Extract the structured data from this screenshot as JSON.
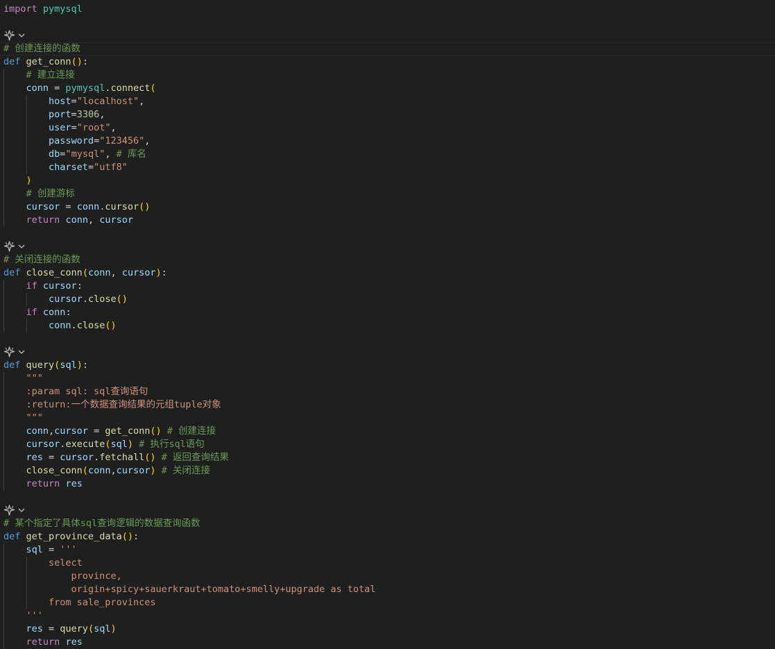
{
  "editor": {
    "lines": [
      [
        {
          "t": "import",
          "c": "ctl"
        },
        {
          "t": " "
        },
        {
          "t": "pymysql",
          "c": "mod"
        }
      ],
      [],
      "LENS",
      [
        {
          "t": "# 创建连接的函数",
          "c": "cm"
        }
      ],
      [
        {
          "t": "def",
          "c": "kw"
        },
        {
          "t": " "
        },
        {
          "t": "get_conn",
          "c": "fn"
        },
        {
          "t": "()",
          "c": "p1"
        },
        {
          "t": ":"
        }
      ],
      [
        {
          "t": "    "
        },
        {
          "t": "# 建立连接",
          "c": "cm"
        }
      ],
      [
        {
          "t": "    "
        },
        {
          "t": "conn",
          "c": "var"
        },
        {
          "t": " = "
        },
        {
          "t": "pymysql",
          "c": "mod"
        },
        {
          "t": "."
        },
        {
          "t": "connect",
          "c": "fn"
        },
        {
          "t": "(",
          "c": "p1"
        }
      ],
      [
        {
          "t": "        "
        },
        {
          "t": "host",
          "c": "var"
        },
        {
          "t": "="
        },
        {
          "t": "\"localhost\"",
          "c": "str"
        },
        {
          "t": ","
        }
      ],
      [
        {
          "t": "        "
        },
        {
          "t": "port",
          "c": "var"
        },
        {
          "t": "="
        },
        {
          "t": "3306",
          "c": "num"
        },
        {
          "t": ","
        }
      ],
      [
        {
          "t": "        "
        },
        {
          "t": "user",
          "c": "var"
        },
        {
          "t": "="
        },
        {
          "t": "\"root\"",
          "c": "str"
        },
        {
          "t": ","
        }
      ],
      [
        {
          "t": "        "
        },
        {
          "t": "password",
          "c": "var"
        },
        {
          "t": "="
        },
        {
          "t": "\"123456\"",
          "c": "str"
        },
        {
          "t": ","
        }
      ],
      [
        {
          "t": "        "
        },
        {
          "t": "db",
          "c": "var"
        },
        {
          "t": "="
        },
        {
          "t": "\"mysql\"",
          "c": "str"
        },
        {
          "t": ", "
        },
        {
          "t": "# 库名",
          "c": "cm"
        }
      ],
      [
        {
          "t": "        "
        },
        {
          "t": "charset",
          "c": "var"
        },
        {
          "t": "="
        },
        {
          "t": "\"utf8\"",
          "c": "str"
        }
      ],
      [
        {
          "t": "    "
        },
        {
          "t": ")",
          "c": "p1"
        }
      ],
      [
        {
          "t": "    "
        },
        {
          "t": "# 创建游标",
          "c": "cm"
        }
      ],
      [
        {
          "t": "    "
        },
        {
          "t": "cursor",
          "c": "var"
        },
        {
          "t": " = "
        },
        {
          "t": "conn",
          "c": "var"
        },
        {
          "t": "."
        },
        {
          "t": "cursor",
          "c": "fn"
        },
        {
          "t": "()",
          "c": "p1"
        }
      ],
      [
        {
          "t": "    "
        },
        {
          "t": "return",
          "c": "ctl"
        },
        {
          "t": " "
        },
        {
          "t": "conn",
          "c": "var"
        },
        {
          "t": ", "
        },
        {
          "t": "cursor",
          "c": "var"
        }
      ],
      [],
      "LENS",
      [
        {
          "t": "# 关闭连接的函数",
          "c": "cm"
        }
      ],
      [
        {
          "t": "def",
          "c": "kw"
        },
        {
          "t": " "
        },
        {
          "t": "close_conn",
          "c": "fn"
        },
        {
          "t": "(",
          "c": "p1"
        },
        {
          "t": "conn",
          "c": "var"
        },
        {
          "t": ", "
        },
        {
          "t": "cursor",
          "c": "var"
        },
        {
          "t": ")",
          "c": "p1"
        },
        {
          "t": ":"
        }
      ],
      [
        {
          "t": "    "
        },
        {
          "t": "if",
          "c": "ctl"
        },
        {
          "t": " "
        },
        {
          "t": "cursor",
          "c": "var"
        },
        {
          "t": ":"
        }
      ],
      [
        {
          "t": "        "
        },
        {
          "t": "cursor",
          "c": "var"
        },
        {
          "t": "."
        },
        {
          "t": "close",
          "c": "fn"
        },
        {
          "t": "()",
          "c": "p1"
        }
      ],
      [
        {
          "t": "    "
        },
        {
          "t": "if",
          "c": "ctl"
        },
        {
          "t": " "
        },
        {
          "t": "conn",
          "c": "var"
        },
        {
          "t": ":"
        }
      ],
      [
        {
          "t": "        "
        },
        {
          "t": "conn",
          "c": "var"
        },
        {
          "t": "."
        },
        {
          "t": "close",
          "c": "fn"
        },
        {
          "t": "()",
          "c": "p1"
        }
      ],
      [],
      "LENS",
      [
        {
          "t": "def",
          "c": "kw"
        },
        {
          "t": " "
        },
        {
          "t": "query",
          "c": "fn"
        },
        {
          "t": "(",
          "c": "p1"
        },
        {
          "t": "sql",
          "c": "var"
        },
        {
          "t": ")",
          "c": "p1"
        },
        {
          "t": ":"
        }
      ],
      [
        {
          "t": "    "
        },
        {
          "t": "\"\"\"",
          "c": "str"
        }
      ],
      [
        {
          "t": "    "
        },
        {
          "t": ":param sql: sql查询语句",
          "c": "str"
        }
      ],
      [
        {
          "t": "    "
        },
        {
          "t": ":return:一个数据查询结果的元组tuple对象",
          "c": "str"
        }
      ],
      [
        {
          "t": "    "
        },
        {
          "t": "\"\"\"",
          "c": "str"
        }
      ],
      [
        {
          "t": "    "
        },
        {
          "t": "conn",
          "c": "var"
        },
        {
          "t": ","
        },
        {
          "t": "cursor",
          "c": "var"
        },
        {
          "t": " = "
        },
        {
          "t": "get_conn",
          "c": "fn"
        },
        {
          "t": "()",
          "c": "p1"
        },
        {
          "t": " "
        },
        {
          "t": "# 创建连接",
          "c": "cm"
        }
      ],
      [
        {
          "t": "    "
        },
        {
          "t": "cursor",
          "c": "var"
        },
        {
          "t": "."
        },
        {
          "t": "execute",
          "c": "fn"
        },
        {
          "t": "(",
          "c": "p1"
        },
        {
          "t": "sql",
          "c": "var"
        },
        {
          "t": ")",
          "c": "p1"
        },
        {
          "t": " "
        },
        {
          "t": "# 执行sql语句",
          "c": "cm"
        }
      ],
      [
        {
          "t": "    "
        },
        {
          "t": "res",
          "c": "var"
        },
        {
          "t": " = "
        },
        {
          "t": "cursor",
          "c": "var"
        },
        {
          "t": "."
        },
        {
          "t": "fetchall",
          "c": "fn"
        },
        {
          "t": "()",
          "c": "p1"
        },
        {
          "t": " "
        },
        {
          "t": "# 返回查询结果",
          "c": "cm"
        }
      ],
      [
        {
          "t": "    "
        },
        {
          "t": "close_conn",
          "c": "fn"
        },
        {
          "t": "(",
          "c": "p1"
        },
        {
          "t": "conn",
          "c": "var"
        },
        {
          "t": ","
        },
        {
          "t": "cursor",
          "c": "var"
        },
        {
          "t": ")",
          "c": "p1"
        },
        {
          "t": " "
        },
        {
          "t": "# 关闭连接",
          "c": "cm"
        }
      ],
      [
        {
          "t": "    "
        },
        {
          "t": "return",
          "c": "ctl"
        },
        {
          "t": " "
        },
        {
          "t": "res",
          "c": "var"
        }
      ],
      [],
      "LENS",
      [
        {
          "t": "# 某个指定了具体sql查询逻辑的数据查询函数",
          "c": "cm"
        }
      ],
      [
        {
          "t": "def",
          "c": "kw"
        },
        {
          "t": " "
        },
        {
          "t": "get_province_data",
          "c": "fn"
        },
        {
          "t": "()",
          "c": "p1"
        },
        {
          "t": ":"
        }
      ],
      [
        {
          "t": "    "
        },
        {
          "t": "sql",
          "c": "var"
        },
        {
          "t": " = "
        },
        {
          "t": "'''",
          "c": "str"
        }
      ],
      [
        {
          "t": "        "
        },
        {
          "t": "select",
          "c": "str"
        }
      ],
      [
        {
          "t": "            "
        },
        {
          "t": "province,",
          "c": "str"
        }
      ],
      [
        {
          "t": "            "
        },
        {
          "t": "origin+spicy+sauerkraut+tomato+smelly+upgrade as total",
          "c": "str"
        }
      ],
      [
        {
          "t": "        "
        },
        {
          "t": "from sale_provinces",
          "c": "str"
        }
      ],
      [
        {
          "t": "    "
        },
        {
          "t": "'''",
          "c": "str"
        }
      ],
      [
        {
          "t": "    "
        },
        {
          "t": "res",
          "c": "var"
        },
        {
          "t": " = "
        },
        {
          "t": "query",
          "c": "fn"
        },
        {
          "t": "(",
          "c": "p1"
        },
        {
          "t": "sql",
          "c": "var"
        },
        {
          "t": ")",
          "c": "p1"
        }
      ],
      [
        {
          "t": "    "
        },
        {
          "t": "return",
          "c": "ctl"
        },
        {
          "t": " "
        },
        {
          "t": "res",
          "c": "var"
        }
      ]
    ]
  },
  "colors": {
    "background": "#1f1f1f",
    "keyword": "#569cd6",
    "control": "#c586c0",
    "function": "#dcdcaa",
    "variable": "#9cdcfe",
    "string": "#ce9178",
    "number": "#b5cea8",
    "comment": "#6a9955",
    "bracket": "#ffd700",
    "module": "#4ec9b0"
  },
  "icons": {
    "code_lens": "ai-sparkle-icon",
    "fold": "chevron-down-icon"
  }
}
